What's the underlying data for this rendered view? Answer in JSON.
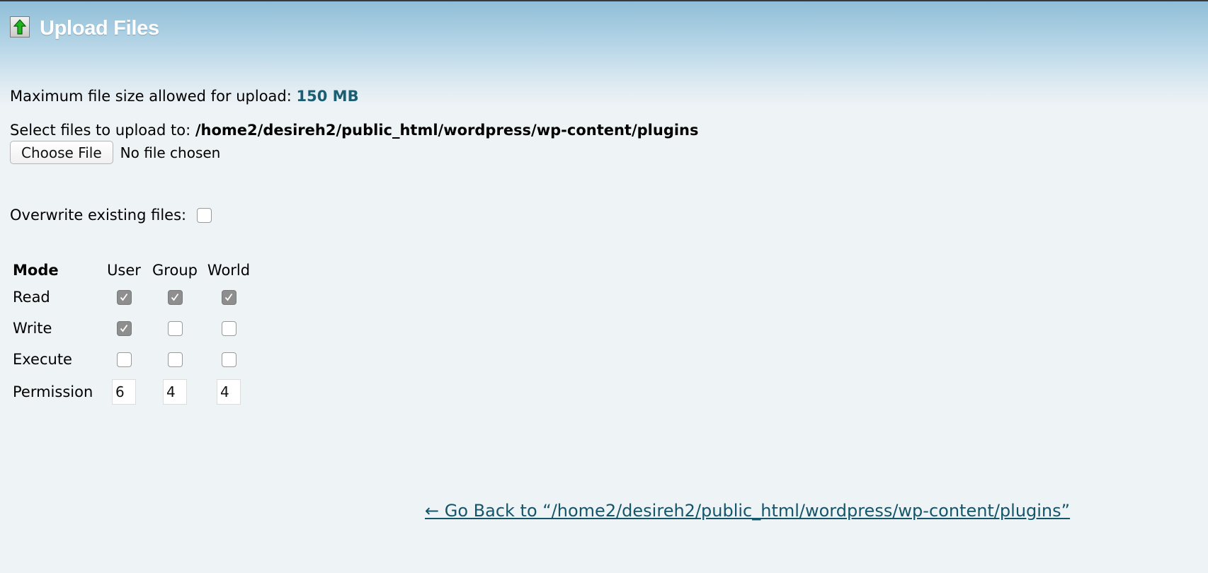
{
  "header": {
    "title": "Upload Files",
    "icon": "upload-arrow-icon"
  },
  "max_size": {
    "label": "Maximum file size allowed for upload:",
    "value": "150 MB"
  },
  "select": {
    "label": "Select files to upload to:",
    "path": "/home2/desireh2/public_html/wordpress/wp-content/plugins"
  },
  "file_input": {
    "button_label": "Choose File",
    "status": "No file chosen"
  },
  "overwrite": {
    "label": "Overwrite existing files:",
    "checked": false
  },
  "permissions": {
    "headers": {
      "mode": "Mode",
      "user": "User",
      "group": "Group",
      "world": "World"
    },
    "rows": [
      {
        "label": "Read",
        "user": true,
        "group": true,
        "world": true
      },
      {
        "label": "Write",
        "user": true,
        "group": false,
        "world": false
      },
      {
        "label": "Execute",
        "user": false,
        "group": false,
        "world": false
      }
    ],
    "permission_label": "Permission",
    "values": {
      "user": "6",
      "group": "4",
      "world": "4"
    }
  },
  "go_back": {
    "label": "← Go Back to “/home2/desireh2/public_html/wordpress/wp-content/plugins”"
  },
  "colors": {
    "accent": "#1b5d72",
    "link": "#14556a",
    "header_gradient_top": "#8fbdd7",
    "background": "#eef3f6"
  }
}
